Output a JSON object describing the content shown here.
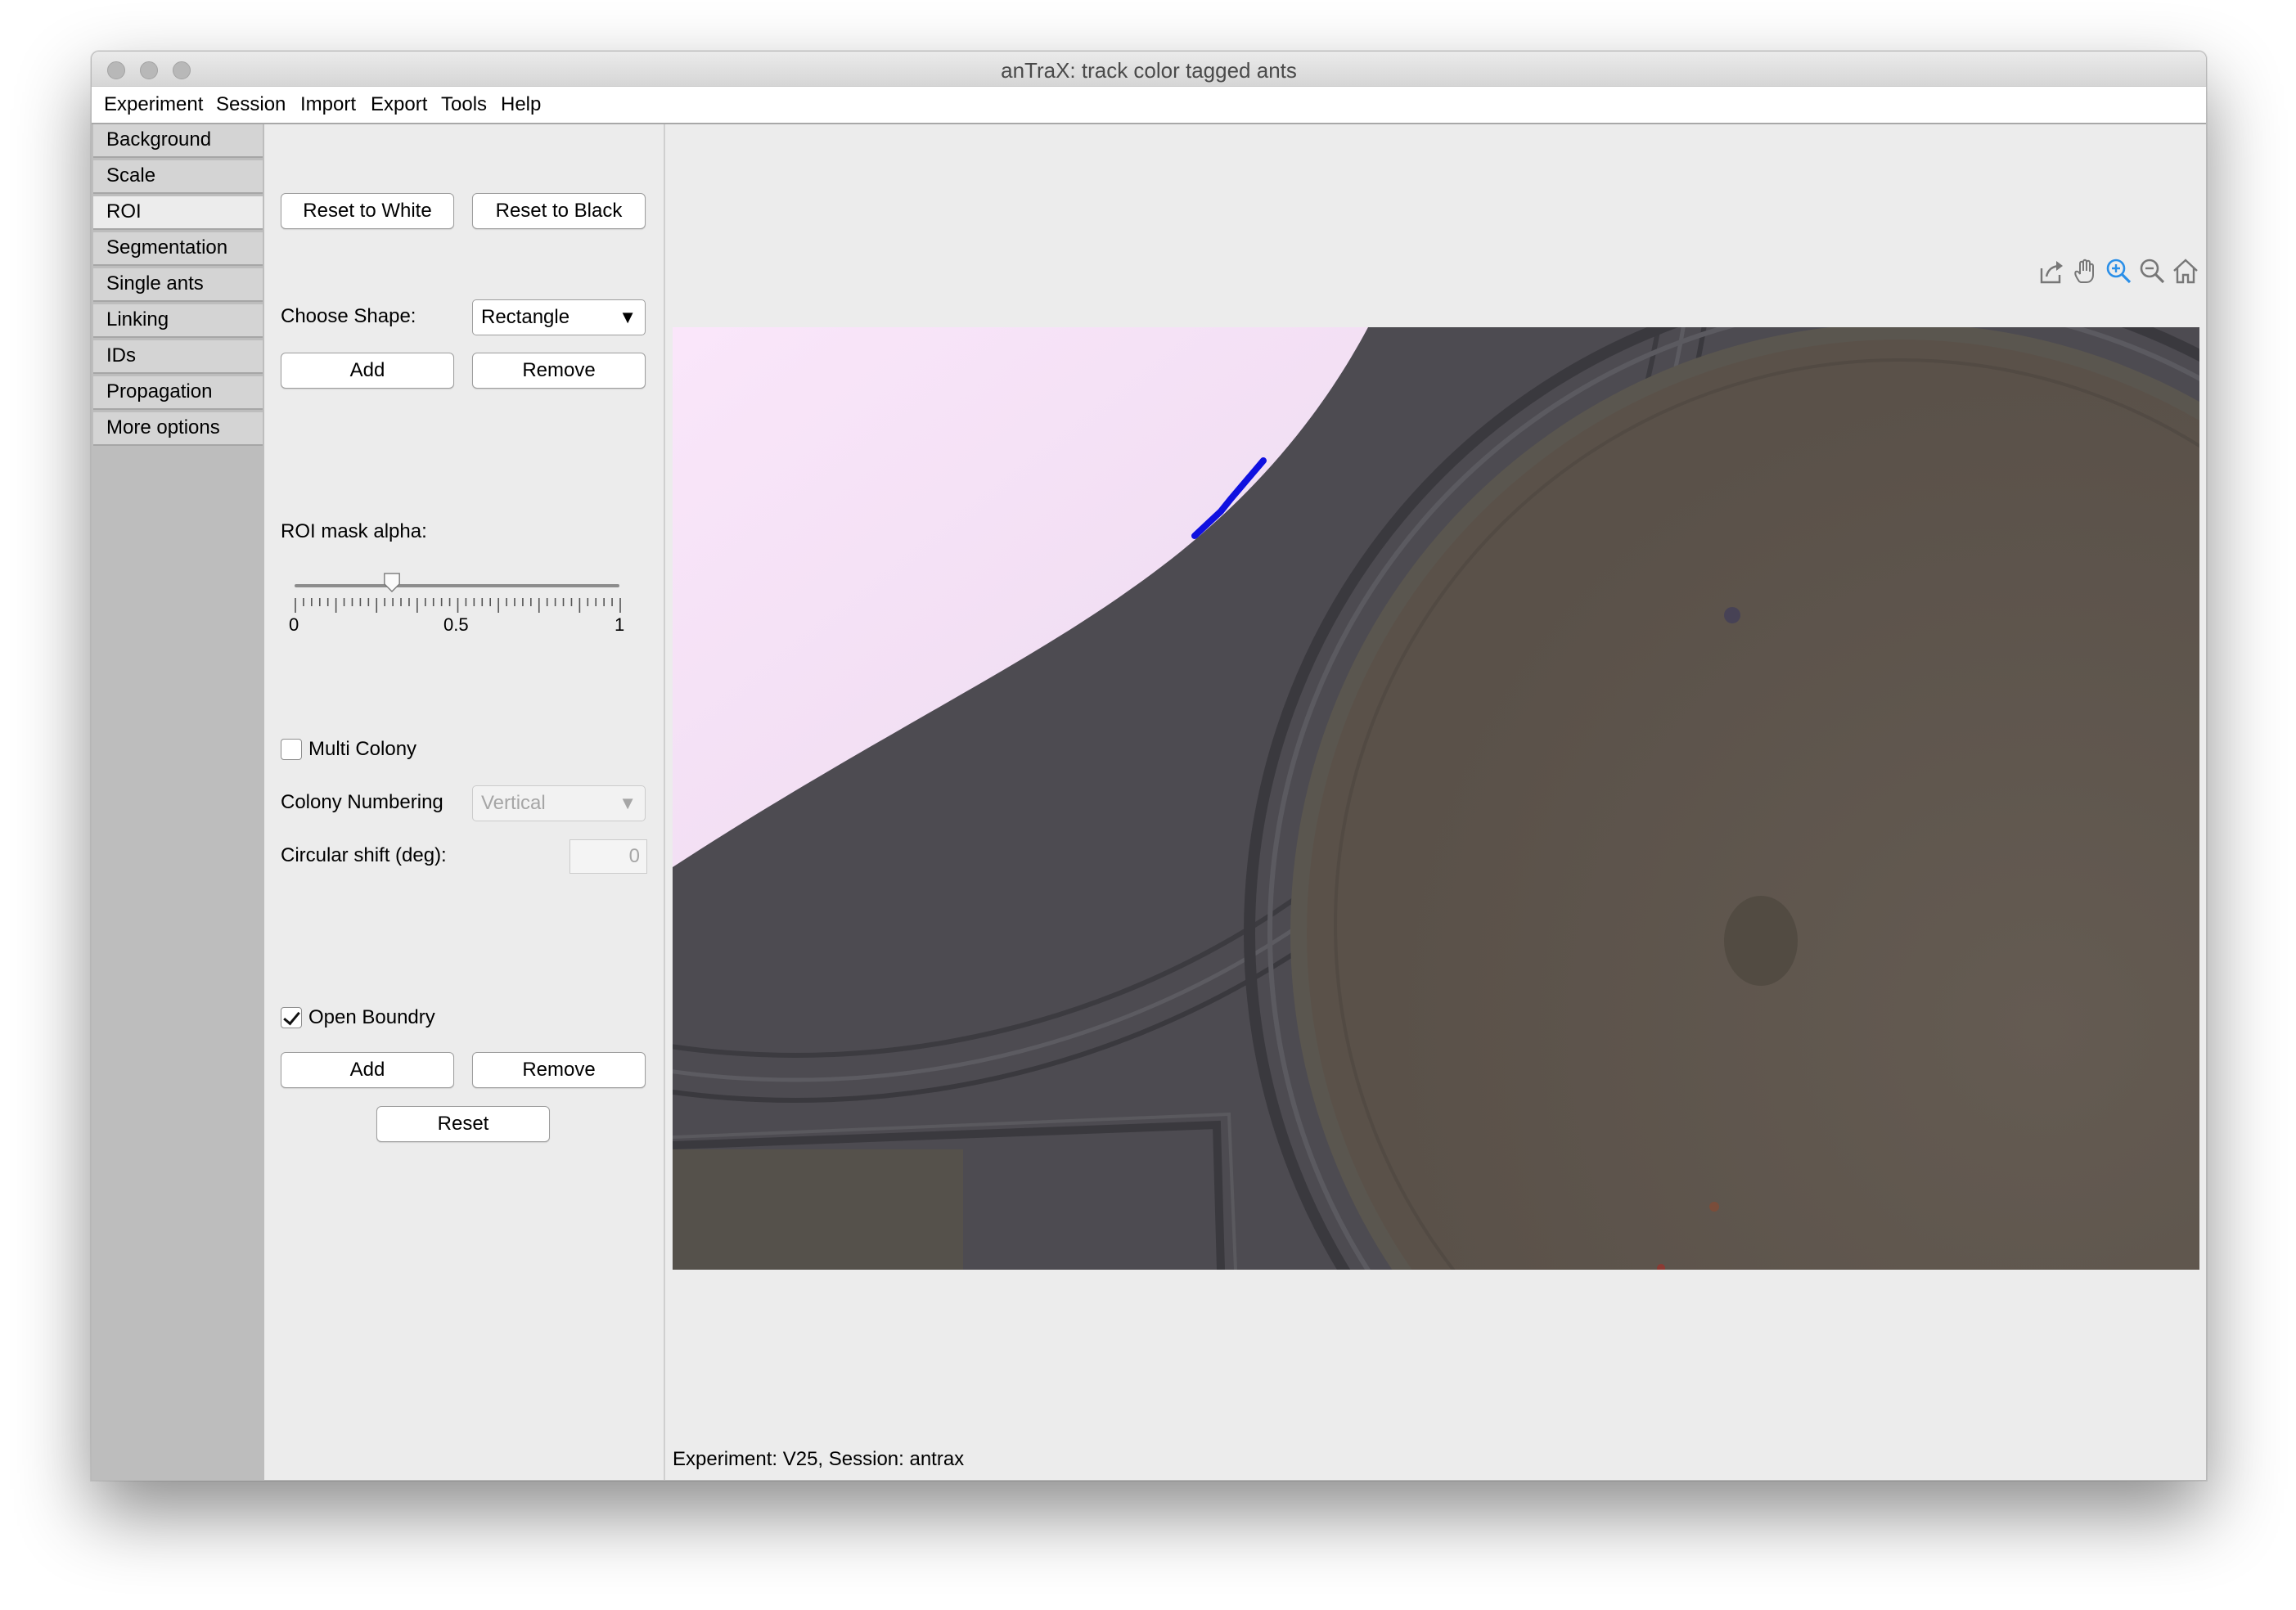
{
  "window": {
    "title": "anTraX: track color tagged ants"
  },
  "menu": [
    "Experiment",
    "Session",
    "Import",
    "Export",
    "Tools",
    "Help"
  ],
  "sidebar": {
    "items": [
      {
        "label": "Background"
      },
      {
        "label": "Scale"
      },
      {
        "label": "ROI",
        "active": true
      },
      {
        "label": "Segmentation"
      },
      {
        "label": "Single ants"
      },
      {
        "label": "Linking"
      },
      {
        "label": "IDs"
      },
      {
        "label": "Propagation"
      },
      {
        "label": "More options"
      }
    ]
  },
  "roi_panel": {
    "reset_white": "Reset to White",
    "reset_black": "Reset to Black",
    "choose_shape_label": "Choose Shape:",
    "shape_value": "Rectangle",
    "add_label": "Add",
    "remove_label": "Remove",
    "mask_alpha_label": "ROI mask alpha:",
    "mask_alpha_value": 0.3,
    "slider_ticks": [
      "0",
      "0.5",
      "1"
    ],
    "multi_colony_label": "Multi Colony",
    "multi_colony_checked": false,
    "colony_numbering_label": "Colony Numbering",
    "colony_numbering_value": "Vertical",
    "circular_shift_label": "Circular shift (deg):",
    "circular_shift_value": "0",
    "open_boundary_label": "Open Boundry",
    "open_boundary_checked": true,
    "boundary_add_label": "Add",
    "boundary_remove_label": "Remove",
    "reset_label": "Reset"
  },
  "axes_toolbar": [
    "export-icon",
    "pan-hand-icon",
    "zoom-in-icon",
    "zoom-out-icon",
    "home-icon"
  ],
  "status": "Experiment: V25, Session: antrax",
  "colors": {
    "boundary_line": "#1010e0",
    "mask_tint": "#f6e3f8",
    "zoom_active": "#2a8fe8"
  }
}
